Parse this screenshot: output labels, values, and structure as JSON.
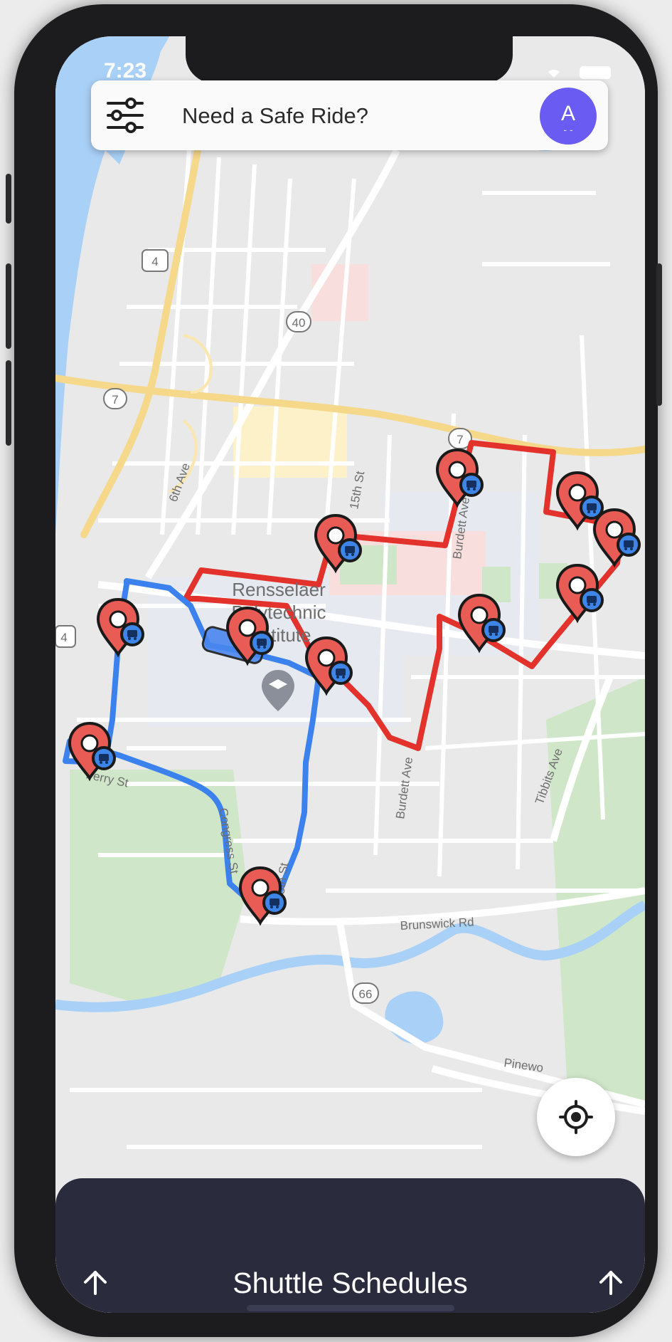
{
  "status_bar": {
    "time": "7:23"
  },
  "search_bar": {
    "placeholder_text": "Need a Safe Ride?",
    "avatar_initial": "A",
    "avatar_dots": "- -"
  },
  "map": {
    "labels": {
      "campus_line1": "Rensselaer",
      "campus_line2": "Polytechnic",
      "campus_line3": "Institute",
      "street_6th_ave": "6th Ave",
      "street_15th_st": "15th St",
      "street_15th_st_south": "15th St",
      "street_burdett_ave_north": "Burdett Ave",
      "street_burdett_ave_south": "Burdett Ave",
      "street_ferry_st": "Ferry St",
      "street_congress_st": "Congress St",
      "street_tibbits_ave": "Tibbits Ave",
      "street_brunswick_rd": "Brunswick Rd",
      "street_pinewoods": "Pinewo",
      "shield_us4_north": "4",
      "shield_us4_west": "4",
      "shield_40": "40",
      "shield_7_west": "7",
      "shield_7_east": "7",
      "shield_66": "66"
    },
    "route_colors": {
      "red_route": "#e3322b",
      "blue_route": "#3b82ee"
    },
    "stop_pin_color": "#e95b55",
    "bus_badge_color": "#3d85e6"
  },
  "bottom_sheet": {
    "title": "Shuttle Schedules",
    "left_icon": "arrow-up-icon",
    "right_icon": "arrow-up-icon"
  },
  "locate_button": {
    "icon": "crosshair-icon"
  }
}
